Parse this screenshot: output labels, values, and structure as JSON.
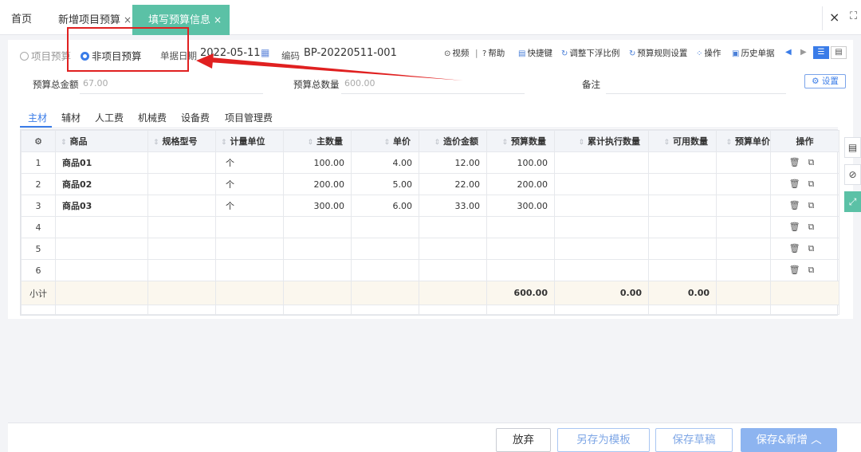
{
  "tabs": [
    {
      "label": "首页",
      "closable": false
    },
    {
      "label": "新增项目预算",
      "closable": true
    },
    {
      "label": "填写预算信息",
      "closable": true
    }
  ],
  "close_glyph": "×",
  "window": {
    "close": "×",
    "fullscreen": "⛶"
  },
  "budget_types": {
    "project": "项目预算",
    "non_project": "非项目预算"
  },
  "doc": {
    "date_label": "单据日期",
    "date_value": "2022-05-11",
    "code_label": "编码",
    "code_value": "BP-20220511-001"
  },
  "toolbar": {
    "video": "视频",
    "help": "帮助",
    "shortcut": "快捷键",
    "float_ratio": "调整下浮比例",
    "rule_settings": "预算规则设置",
    "operate": "操作",
    "history": "历史单据"
  },
  "summary": {
    "total_amount_label": "预算总金额",
    "total_amount_value": "67.00",
    "total_qty_label": "预算总数量",
    "total_qty_value": "600.00",
    "remark_label": "备注",
    "settings_button": "设置"
  },
  "subtabs": [
    "主材",
    "辅材",
    "人工费",
    "机械费",
    "设备费",
    "项目管理费"
  ],
  "grid": {
    "columns": [
      "商品",
      "规格型号",
      "计量单位",
      "主数量",
      "单价",
      "造价金额",
      "预算数量",
      "累计执行数量",
      "可用数量",
      "预算单价",
      "操作"
    ],
    "header_display": [
      "商品",
      "规格型号",
      "计量单位",
      "主数量",
      "单价",
      "造价金额",
      "预算数量",
      "累计执行数量",
      "可用数量",
      "预算单价",
      "操作"
    ],
    "rows": [
      {
        "idx": "1",
        "name": "商品01",
        "spec": "",
        "unit": "个",
        "qty": "100.00",
        "price": "4.00",
        "cost": "12.00",
        "budget_qty": "100.00",
        "executed": "",
        "available": "",
        "budget_price": ""
      },
      {
        "idx": "2",
        "name": "商品02",
        "spec": "",
        "unit": "个",
        "qty": "200.00",
        "price": "5.00",
        "cost": "22.00",
        "budget_qty": "200.00",
        "executed": "",
        "available": "",
        "budget_price": ""
      },
      {
        "idx": "3",
        "name": "商品03",
        "spec": "",
        "unit": "个",
        "qty": "300.00",
        "price": "6.00",
        "cost": "33.00",
        "budget_qty": "300.00",
        "executed": "",
        "available": "",
        "budget_price": ""
      },
      {
        "idx": "4",
        "name": "",
        "spec": "",
        "unit": "",
        "qty": "",
        "price": "",
        "cost": "",
        "budget_qty": "",
        "executed": "",
        "available": "",
        "budget_price": ""
      },
      {
        "idx": "5",
        "name": "",
        "spec": "",
        "unit": "",
        "qty": "",
        "price": "",
        "cost": "",
        "budget_qty": "",
        "executed": "",
        "available": "",
        "budget_price": ""
      },
      {
        "idx": "6",
        "name": "",
        "spec": "",
        "unit": "",
        "qty": "",
        "price": "",
        "cost": "",
        "budget_qty": "",
        "executed": "",
        "available": "",
        "budget_price": ""
      }
    ],
    "subtotal": {
      "label": "小计",
      "budget_qty": "600.00",
      "executed": "0.00",
      "available": "0.00"
    }
  },
  "buttons": {
    "discard": "放弃",
    "save_template": "另存为模板",
    "save_draft": "保存草稿",
    "save_new": "保存&新增"
  },
  "colors": {
    "accent": "#3a7ce8",
    "active_tab": "#5bc1a6",
    "annotation": "#e02020"
  }
}
